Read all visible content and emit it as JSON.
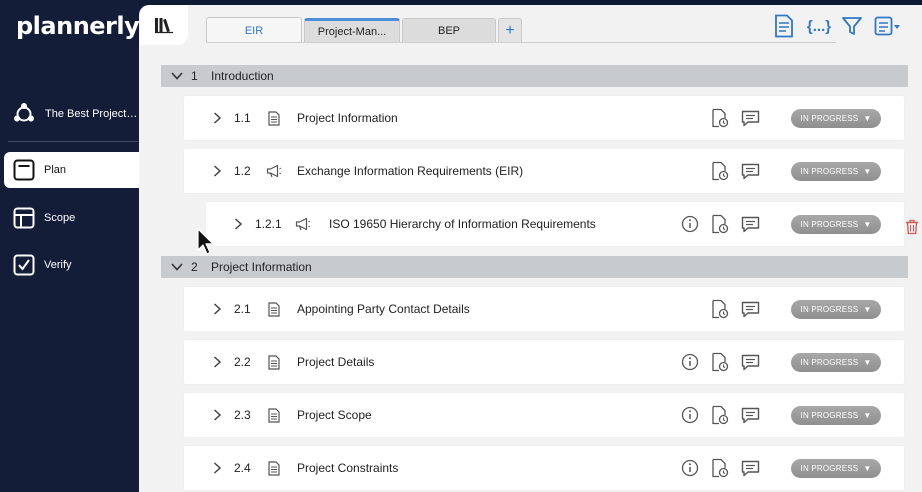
{
  "sidebar": {
    "logo": "plannerly",
    "project_name": "The Best Project E...",
    "nav": [
      {
        "label": "Plan",
        "icon": "plan-icon",
        "active": true
      },
      {
        "label": "Scope",
        "icon": "scope-icon",
        "active": false
      },
      {
        "label": "Verify",
        "icon": "verify-icon",
        "active": false
      }
    ]
  },
  "tabs": [
    {
      "label": "EIR",
      "active": true
    },
    {
      "label": "Project-Man...",
      "active": false
    },
    {
      "label": "BEP",
      "active": false
    },
    {
      "label": "+",
      "active": false
    }
  ],
  "toolbar": {
    "icons": [
      "document-icon",
      "braces-icon",
      "filter-icon",
      "list-menu-icon"
    ],
    "braces_text": "{...}"
  },
  "sections": [
    {
      "number": "1",
      "title": "Introduction",
      "rows": [
        {
          "number": "1.1",
          "title": "Project Information",
          "icon": "document-icon",
          "info": false,
          "status": "IN PROGRESS"
        },
        {
          "number": "1.2",
          "title": "Exchange Information Requirements (EIR)",
          "icon": "megaphone-icon",
          "info": false,
          "status": "IN PROGRESS"
        },
        {
          "number": "1.2.1",
          "title": "ISO 19650 Hierarchy of Information Requirements",
          "icon": "megaphone-icon",
          "info": true,
          "status": "IN PROGRESS",
          "trash": true
        }
      ]
    },
    {
      "number": "2",
      "title": "Project Information",
      "rows": [
        {
          "number": "2.1",
          "title": "Appointing Party Contact Details",
          "icon": "document-icon",
          "info": false,
          "status": "IN PROGRESS"
        },
        {
          "number": "2.2",
          "title": "Project Details",
          "icon": "document-icon",
          "info": true,
          "status": "IN PROGRESS"
        },
        {
          "number": "2.3",
          "title": "Project Scope",
          "icon": "document-icon",
          "info": true,
          "status": "IN PROGRESS"
        },
        {
          "number": "2.4",
          "title": "Project Constraints",
          "icon": "document-icon",
          "info": true,
          "status": "IN PROGRESS"
        }
      ]
    }
  ],
  "colors": {
    "sidebar": "#131d38",
    "accent": "#2e78c7",
    "status": "#9a9a9a",
    "trash": "#d9534f"
  }
}
